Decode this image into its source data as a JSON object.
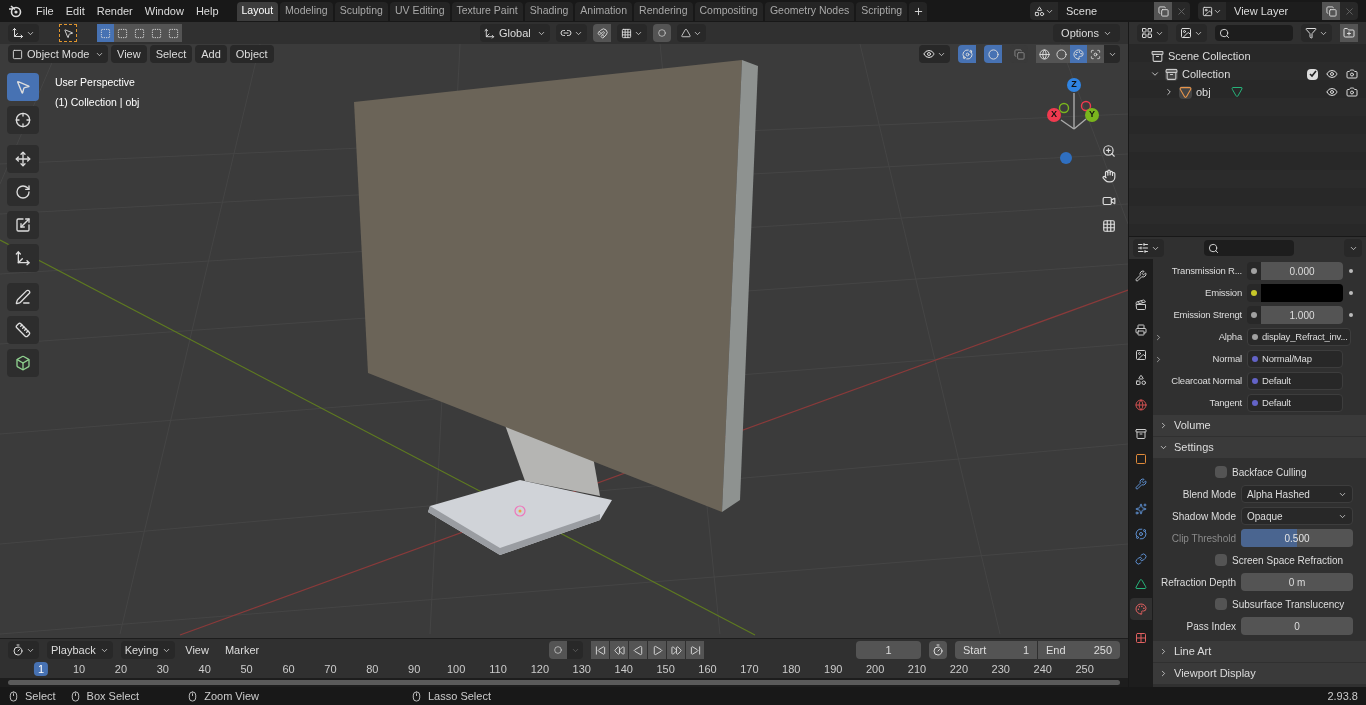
{
  "menu": [
    "File",
    "Edit",
    "Render",
    "Window",
    "Help"
  ],
  "workspaces": [
    {
      "label": "Layout",
      "selected": true
    },
    {
      "label": "Modeling",
      "selected": false
    },
    {
      "label": "Sculpting",
      "selected": false
    },
    {
      "label": "UV Editing",
      "selected": false
    },
    {
      "label": "Texture Paint",
      "selected": false
    },
    {
      "label": "Shading",
      "selected": false
    },
    {
      "label": "Animation",
      "selected": false
    },
    {
      "label": "Rendering",
      "selected": false
    },
    {
      "label": "Compositing",
      "selected": false
    },
    {
      "label": "Geometry Nodes",
      "selected": false
    },
    {
      "label": "Scripting",
      "selected": false
    }
  ],
  "scene": "Scene",
  "view_layer": "View Layer",
  "tool_header": {
    "select_modes": [
      {
        "selected": true
      },
      {
        "selected": false
      },
      {
        "selected": false
      },
      {
        "selected": false
      },
      {
        "selected": false
      }
    ],
    "orientation": "Global",
    "options": "Options"
  },
  "viewport_header": {
    "mode": "Object Mode",
    "menus": [
      "View",
      "Select",
      "Add",
      "Object"
    ],
    "gizmos_on": true,
    "overlays_on": true,
    "shading": [
      {
        "kind": "wireframe",
        "selected": false
      },
      {
        "kind": "solid",
        "selected": false
      },
      {
        "kind": "material",
        "selected": true
      },
      {
        "kind": "rendered",
        "selected": false
      }
    ]
  },
  "viewport": {
    "info": [
      "User Perspective",
      "(1) Collection | obj"
    ],
    "gizmo": [
      {
        "label": "Z",
        "color": "#2f84e3"
      },
      {
        "label": "Y",
        "color": "#7ab51d"
      },
      {
        "label": "X",
        "color": "#f03a4f"
      }
    ]
  },
  "toolbar": [
    {
      "kind": "select",
      "selected": true
    },
    {
      "kind": "cursor",
      "selected": false
    },
    {
      "kind": "move",
      "selected": false
    },
    {
      "kind": "rotate",
      "selected": false
    },
    {
      "kind": "scale",
      "selected": false
    },
    {
      "kind": "transform",
      "selected": false
    },
    {
      "kind": "annotate",
      "selected": false
    },
    {
      "kind": "measure",
      "selected": false
    },
    {
      "kind": "add_cube",
      "selected": false
    }
  ],
  "outliner": {
    "tree": [
      {
        "label": "Scene Collection",
        "kind": "scene",
        "children": [
          {
            "label": "Collection",
            "kind": "collection",
            "expanded": true,
            "checked": true,
            "children": [
              {
                "label": "obj",
                "kind": "object",
                "expanded": false
              }
            ]
          }
        ]
      }
    ]
  },
  "properties": {
    "tabs": [
      {
        "kind": "tool",
        "selected": false
      },
      {
        "kind": "render",
        "selected": false
      },
      {
        "kind": "output",
        "selected": false
      },
      {
        "kind": "view_layer",
        "selected": false
      },
      {
        "kind": "scene",
        "selected": false
      },
      {
        "kind": "world",
        "selected": false
      },
      {
        "kind": "collection",
        "selected": false
      },
      {
        "kind": "object",
        "selected": false
      },
      {
        "kind": "modifiers",
        "selected": false
      },
      {
        "kind": "particles",
        "selected": false
      },
      {
        "kind": "physics",
        "selected": false
      },
      {
        "kind": "constraints",
        "selected": false
      },
      {
        "kind": "data",
        "selected": false
      },
      {
        "kind": "material",
        "selected": true
      },
      {
        "kind": "texture",
        "selected": false
      }
    ],
    "inputs": [
      {
        "kind": "number",
        "label": "Transmission R...",
        "value": "0.000",
        "color": "#a1a1a1"
      },
      {
        "kind": "swatch",
        "label": "Emission",
        "color": "#c7c729"
      },
      {
        "kind": "number",
        "label": "Emission Strengt",
        "value": "1.000",
        "color": "#a1a1a1"
      },
      {
        "kind": "link",
        "label": "Alpha",
        "value": "display_Refract_inv...",
        "color": "#a1a1a1",
        "expanded": false
      },
      {
        "kind": "link",
        "label": "Normal",
        "value": "Normal/Map",
        "color": "#6363c7",
        "expanded": false
      },
      {
        "kind": "link",
        "label": "Clearcoat Normal",
        "value": "Default",
        "color": "#6363c7"
      },
      {
        "kind": "link",
        "label": "Tangent",
        "value": "Default",
        "color": "#6363c7"
      }
    ],
    "panels": [
      {
        "label": "Volume",
        "expanded": false
      },
      {
        "label": "Settings",
        "expanded": true,
        "rows": [
          {
            "kind": "checkbox",
            "label": "Backface Culling",
            "checked": false
          },
          {
            "kind": "dropdown",
            "label": "Blend Mode",
            "value": "Alpha Hashed"
          },
          {
            "kind": "dropdown",
            "label": "Shadow Mode",
            "value": "Opaque"
          },
          {
            "kind": "slider",
            "label": "Clip Threshold",
            "value": "0.500",
            "level": 0.5,
            "disabled": true
          },
          {
            "kind": "checkbox",
            "label": "Screen Space Refraction",
            "checked": false
          },
          {
            "kind": "number",
            "label": "Refraction Depth",
            "value": "0 m"
          },
          {
            "kind": "checkbox",
            "label": "Subsurface Translucency",
            "checked": false
          },
          {
            "kind": "number",
            "label": "Pass Index",
            "value": "0"
          }
        ]
      },
      {
        "label": "Line Art",
        "expanded": false
      },
      {
        "label": "Viewport Display",
        "expanded": false
      }
    ]
  },
  "timeline": {
    "menus": [
      {
        "label": "Playback",
        "kind": "dropdown"
      },
      {
        "label": "Keying",
        "kind": "dropdown"
      },
      {
        "label": "View",
        "kind": "menu"
      },
      {
        "label": "Marker",
        "kind": "menu"
      }
    ],
    "current_frame": "1",
    "start_label": "Start",
    "start": "1",
    "end_label": "End",
    "end": "250",
    "frames": [
      {
        "label": "1",
        "selected": true
      },
      {
        "label": "10",
        "selected": false
      },
      {
        "label": "20",
        "selected": false
      },
      {
        "label": "30",
        "selected": false
      },
      {
        "label": "40",
        "selected": false
      },
      {
        "label": "50",
        "selected": false
      },
      {
        "label": "60",
        "selected": false
      },
      {
        "label": "70",
        "selected": false
      },
      {
        "label": "80",
        "selected": false
      },
      {
        "label": "90",
        "selected": false
      },
      {
        "label": "100",
        "selected": false
      },
      {
        "label": "110",
        "selected": false
      },
      {
        "label": "120",
        "selected": false
      },
      {
        "label": "130",
        "selected": false
      },
      {
        "label": "140",
        "selected": false
      },
      {
        "label": "150",
        "selected": false
      },
      {
        "label": "160",
        "selected": false
      },
      {
        "label": "170",
        "selected": false
      },
      {
        "label": "180",
        "selected": false
      },
      {
        "label": "190",
        "selected": false
      },
      {
        "label": "200",
        "selected": false
      },
      {
        "label": "210",
        "selected": false
      },
      {
        "label": "220",
        "selected": false
      },
      {
        "label": "230",
        "selected": false
      },
      {
        "label": "240",
        "selected": false
      },
      {
        "label": "250",
        "selected": false
      }
    ]
  },
  "status": [
    {
      "label": "Select"
    },
    {
      "label": "Box Select"
    },
    {
      "label": "Zoom View"
    },
    {
      "label": "Lasso Select"
    }
  ],
  "version": "2.93.8"
}
